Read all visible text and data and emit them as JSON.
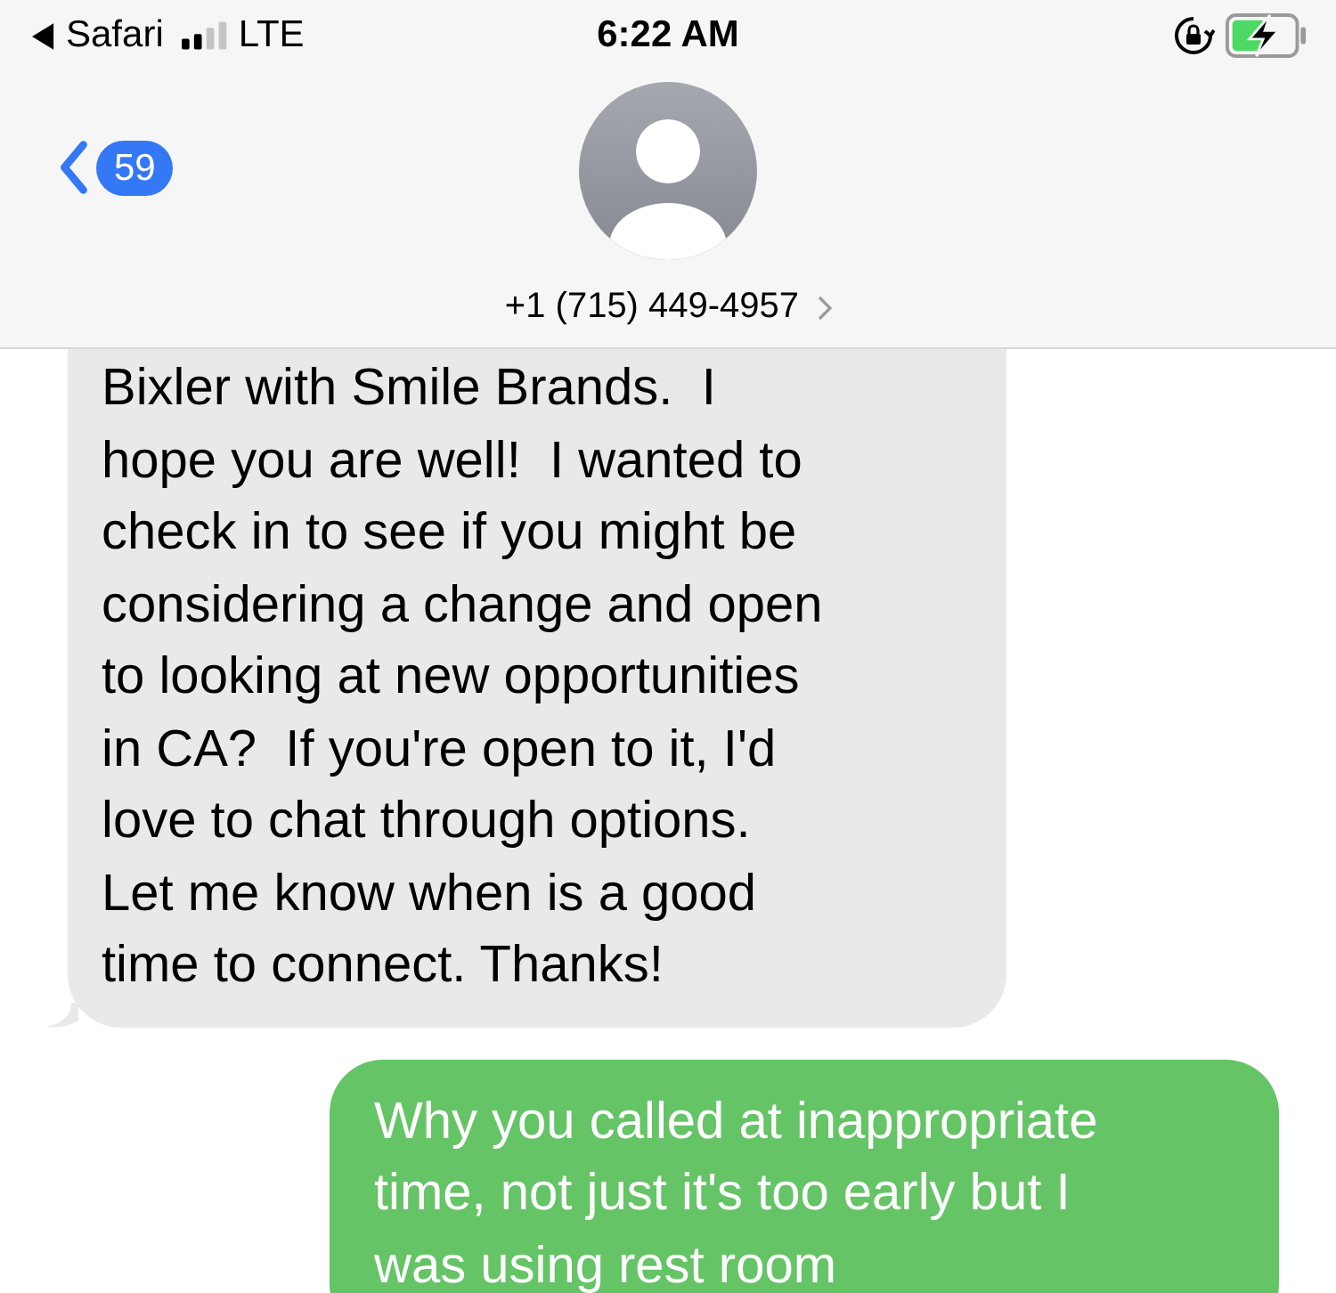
{
  "status_bar": {
    "back_app": "Safari",
    "carrier": "LTE",
    "time": "6:22 AM",
    "charging": true
  },
  "header": {
    "unread_count": "59",
    "contact": "+1 (715) 449-4957"
  },
  "messages": [
    {
      "kind": "incoming",
      "lines": [
        "Bixler with Smile Brands.  I",
        "hope you are well!  I wanted to",
        "check in to see if you might be",
        "considering a change and open",
        "to looking at new opportunities",
        "in CA?  If you're open to it, I'd",
        "love to chat through options.",
        "Let me know when is a good",
        "time to connect. Thanks!"
      ]
    },
    {
      "kind": "outgoing",
      "lines": [
        "Why you called at inappropriate",
        "time, not just it's too early but I",
        "was using rest room"
      ]
    }
  ]
}
